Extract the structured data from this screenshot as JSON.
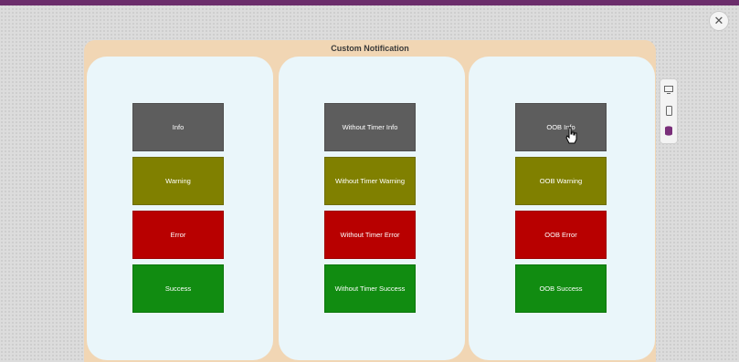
{
  "dialog": {
    "title": "Custom Notification",
    "close_icon": "close-icon"
  },
  "colors": {
    "info": "#5d5d5d",
    "warning": "#808000",
    "error": "#b80000",
    "success": "#118c11"
  },
  "panels": [
    {
      "buttons": [
        {
          "label": "Info",
          "type": "info"
        },
        {
          "label": "Warning",
          "type": "warning"
        },
        {
          "label": "Error",
          "type": "error"
        },
        {
          "label": "Success",
          "type": "success"
        }
      ]
    },
    {
      "buttons": [
        {
          "label": "Without Timer Info",
          "type": "info"
        },
        {
          "label": "Without Timer Warning",
          "type": "warning"
        },
        {
          "label": "Without Timer Error",
          "type": "error"
        },
        {
          "label": "Without Timer Success",
          "type": "success"
        }
      ]
    },
    {
      "buttons": [
        {
          "label": "OOB Info",
          "type": "info"
        },
        {
          "label": "OOB Warning",
          "type": "warning"
        },
        {
          "label": "OOB Error",
          "type": "error"
        },
        {
          "label": "OOB Success",
          "type": "success"
        }
      ]
    }
  ],
  "toolbar": {
    "icons": [
      "desktop-icon",
      "mobile-icon",
      "database-icon"
    ]
  }
}
